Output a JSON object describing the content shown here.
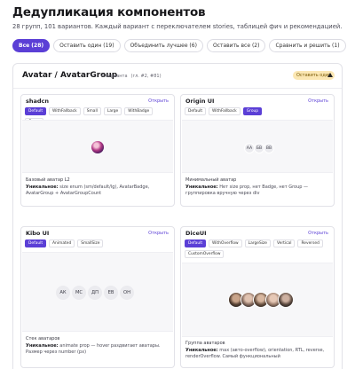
{
  "page": {
    "title": "Дедупликация компонентов",
    "subtitle": "28 групп, 101 вариантов. Каждый вариант с переключателем stories, таблицей фич и рекомендацией."
  },
  "filters": [
    {
      "label": "Все (28)",
      "active": true
    },
    {
      "label": "Оставить один (19)",
      "active": false
    },
    {
      "label": "Объединить лучшее (6)",
      "active": false
    },
    {
      "label": "Оставить все (2)",
      "active": false
    },
    {
      "label": "Сравнить и решить (1)",
      "active": false
    }
  ],
  "group": {
    "title": "Avatar / AvatarGroup",
    "count": "4 варианта",
    "ref": "(гл. #2, #81)",
    "badge": "Оставить один",
    "collapse_icon": "chevron-up-icon"
  },
  "cards": {
    "shadcn": {
      "name": "shadcn",
      "open": "Открыть",
      "variants": [
        "Default",
        "WithFallback",
        "Small",
        "Large",
        "WithBadge",
        "Group"
      ],
      "desc": "Базовый аватар L2",
      "note_label": "Уникальное:",
      "note_text": "size enum (sm/default/lg), AvatarBadge, AvatarGroup + AvatarGroupCount"
    },
    "origin": {
      "name": "Origin UI",
      "open": "Открыть",
      "variants": [
        "Default",
        "WithFallback",
        "Group"
      ],
      "avatars": [
        "AA",
        "БВ",
        "ВВ"
      ],
      "desc": "Минимальный аватар",
      "note_label": "Уникальное:",
      "note_text": "Нет size prop, нет Badge, нет Group — группировка вручную через div"
    },
    "kibo": {
      "name": "Kibo UI",
      "open": "Открыть",
      "variants": [
        "Default",
        "Animated",
        "SmallSize"
      ],
      "avatars": [
        "АК",
        "МС",
        "ДП",
        "ЕВ",
        "ОН"
      ],
      "desc": "Стек аватаров",
      "note_label": "Уникальное:",
      "note_text": "animate prop — hover раздвигает аватары. Размер через number (px)"
    },
    "dice": {
      "name": "DiceUI",
      "open": "Открыть",
      "variants": [
        "Default",
        "WithOverflow",
        "LargeSize",
        "Vertical",
        "Reversed",
        "CustomOverflow"
      ],
      "desc": "Группа аватаров",
      "note_label": "Уникальное:",
      "note_text": "max (авто-overflow), orientation, RTL, reverse, renderOverflow. Самый функциональный"
    }
  },
  "colors": {
    "accent": "#5b3fd6",
    "badge_bg": "#fbe7b3",
    "badge_text": "#7a5a06"
  }
}
